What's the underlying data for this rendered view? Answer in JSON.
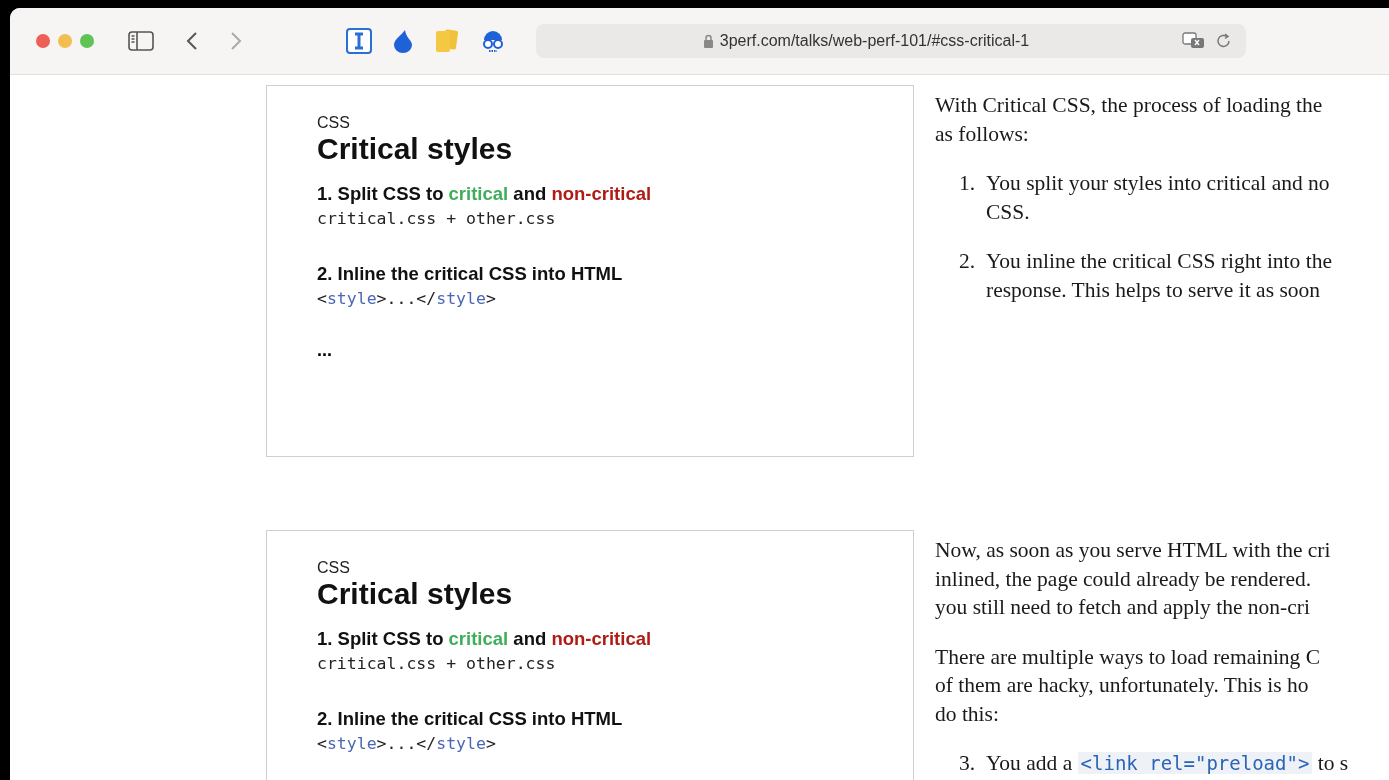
{
  "toolbar": {
    "url": "3perf.com/talks/web-perf-101/#css-critical-1"
  },
  "sections": [
    {
      "slide": {
        "eyebrow": "CSS",
        "title": "Critical styles",
        "points": [
          {
            "heading": [
              {
                "text": "1. Split CSS to ",
                "color": "#111111"
              },
              {
                "text": "critical",
                "color": "#3fae5a"
              },
              {
                "text": " and ",
                "color": "#111111"
              },
              {
                "text": "non-critical",
                "color": "#b01c14"
              }
            ],
            "code": [
              {
                "kind": "plain",
                "text": "critical.css + other.css"
              }
            ]
          },
          {
            "heading": [
              {
                "text": "2. Inline the critical CSS into HTML",
                "color": "#111111"
              }
            ],
            "code": [
              {
                "kind": "plain",
                "text": "<"
              },
              {
                "kind": "tag",
                "text": "style"
              },
              {
                "kind": "plain",
                "text": ">...</"
              },
              {
                "kind": "tag",
                "text": "style"
              },
              {
                "kind": "plain",
                "text": ">"
              }
            ]
          }
        ],
        "ellipsis": "..."
      },
      "blocks": [
        {
          "kind": "paragraph",
          "lines": [
            "With Critical CSS, the process of loading the",
            "as follows:"
          ]
        },
        {
          "kind": "item",
          "number": "1.",
          "lines": [
            "You split your styles into critical and no",
            "CSS."
          ]
        },
        {
          "kind": "item",
          "number": "2.",
          "lines": [
            "You inline the critical CSS right into the",
            "response. This helps to serve it as soon"
          ]
        }
      ]
    },
    {
      "slide": {
        "eyebrow": "CSS",
        "title": "Critical styles",
        "points": [
          {
            "heading": [
              {
                "text": "1. Split CSS to ",
                "color": "#111111"
              },
              {
                "text": "critical",
                "color": "#3fae5a"
              },
              {
                "text": " and ",
                "color": "#111111"
              },
              {
                "text": "non-critical",
                "color": "#b01c14"
              }
            ],
            "code": [
              {
                "kind": "plain",
                "text": "critical.css + other.css"
              }
            ]
          },
          {
            "heading": [
              {
                "text": "2. Inline the critical CSS into HTML",
                "color": "#111111"
              }
            ],
            "code": [
              {
                "kind": "plain",
                "text": "<"
              },
              {
                "kind": "tag",
                "text": "style"
              },
              {
                "kind": "plain",
                "text": ">...</"
              },
              {
                "kind": "tag",
                "text": "style"
              },
              {
                "kind": "plain",
                "text": ">"
              }
            ]
          }
        ]
      },
      "blocks": [
        {
          "kind": "paragraph",
          "lines": [
            "Now, as soon as you serve HTML with the cri",
            "inlined, the page could already be rendered.",
            "you still need to fetch and apply the non-cri"
          ]
        },
        {
          "kind": "paragraph",
          "lines": [
            "There are multiple ways to load remaining C",
            "of them are hacky, unfortunately. This is ho",
            "do this:"
          ]
        },
        {
          "kind": "item",
          "number": "3.",
          "lines": [
            [
              {
                "kind": "text",
                "text": "You add a "
              },
              {
                "kind": "code",
                "text": "<link rel=\"preload\">"
              },
              {
                "kind": "text",
                "text": " to s"
              }
            ]
          ]
        }
      ]
    }
  ]
}
